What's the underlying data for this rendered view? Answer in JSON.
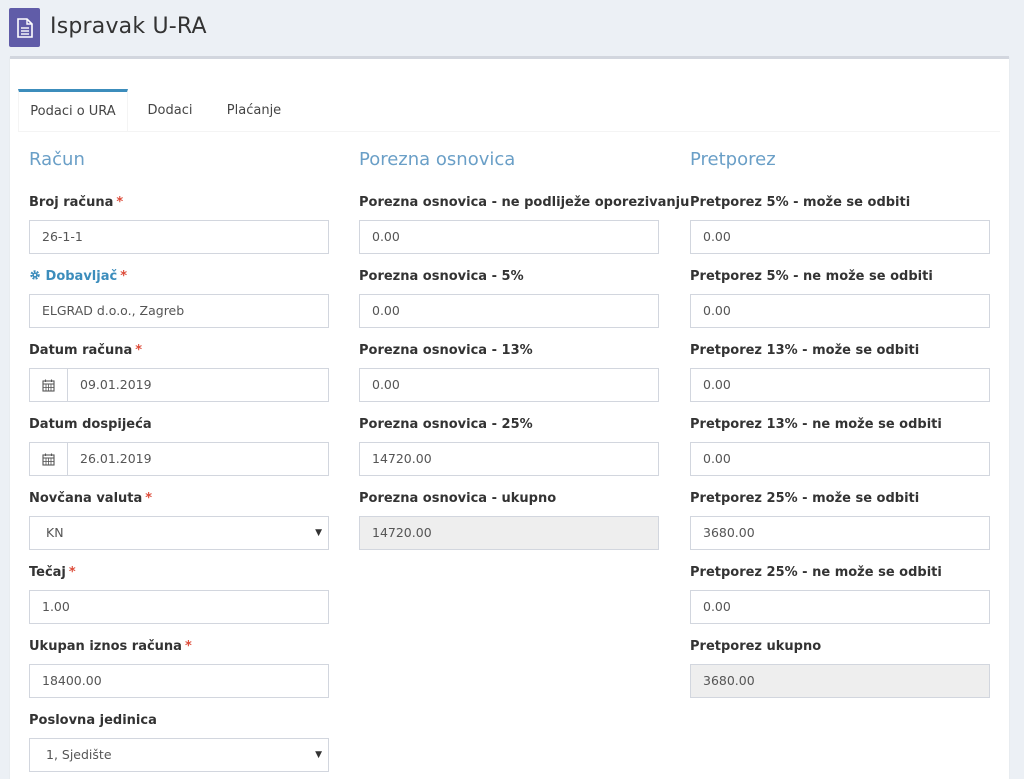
{
  "page": {
    "title": "Ispravak U-RA"
  },
  "icons": {
    "app": "document-icon",
    "calendar": "calendar-icon",
    "gear": "gear-icon",
    "caret": "caret-down-icon"
  },
  "colors": {
    "accent": "#3c8dbc",
    "section_title": "#6a9fc7",
    "required": "#dd4b39",
    "app_icon_bg": "#605ca8"
  },
  "tabs": [
    {
      "label": "Podaci o URA",
      "active": true
    },
    {
      "label": "Dodaci",
      "active": false
    },
    {
      "label": "Plaćanje",
      "active": false
    }
  ],
  "racun": {
    "title": "Račun",
    "broj": {
      "label": "Broj računa",
      "required": "*",
      "value": "26-1-1"
    },
    "dobavljac": {
      "label": "Dobavljač",
      "required": "*",
      "value": "ELGRAD d.o.o., Zagreb"
    },
    "datum_racuna": {
      "label": "Datum računa",
      "required": "*",
      "value": "09.01.2019"
    },
    "datum_dospijeca": {
      "label": "Datum dospijeća",
      "value": "26.01.2019"
    },
    "valuta": {
      "label": "Novčana valuta",
      "required": "*",
      "value": "KN",
      "caret": "▼"
    },
    "tecaj": {
      "label": "Tečaj",
      "required": "*",
      "value": "1.00"
    },
    "ukupan_iznos": {
      "label": "Ukupan iznos računa",
      "required": "*",
      "value": "18400.00"
    },
    "poslovna_jedinica": {
      "label": "Poslovna jedinica",
      "value": "1, Sjedište",
      "caret": "▼"
    }
  },
  "osnovica": {
    "title": "Porezna osnovica",
    "ne_podlijeze": {
      "label": "Porezna osnovica - ne podliježe oporezivanju",
      "value": "0.00"
    },
    "p5": {
      "label": "Porezna osnovica - 5%",
      "value": "0.00"
    },
    "p13": {
      "label": "Porezna osnovica - 13%",
      "value": "0.00"
    },
    "p25": {
      "label": "Porezna osnovica - 25%",
      "value": "14720.00"
    },
    "ukupno": {
      "label": "Porezna osnovica - ukupno",
      "value": "14720.00"
    }
  },
  "pretporez": {
    "title": "Pretporez",
    "p5_moze": {
      "label": "Pretporez 5% - može se odbiti",
      "value": "0.00"
    },
    "p5_ne": {
      "label": "Pretporez 5% - ne može se odbiti",
      "value": "0.00"
    },
    "p13_moze": {
      "label": "Pretporez 13% - može se odbiti",
      "value": "0.00"
    },
    "p13_ne": {
      "label": "Pretporez 13% - ne može se odbiti",
      "value": "0.00"
    },
    "p25_moze": {
      "label": "Pretporez 25% - može se odbiti",
      "value": "3680.00"
    },
    "p25_ne": {
      "label": "Pretporez 25% - ne može se odbiti",
      "value": "0.00"
    },
    "ukupno": {
      "label": "Pretporez ukupno",
      "value": "3680.00"
    }
  }
}
